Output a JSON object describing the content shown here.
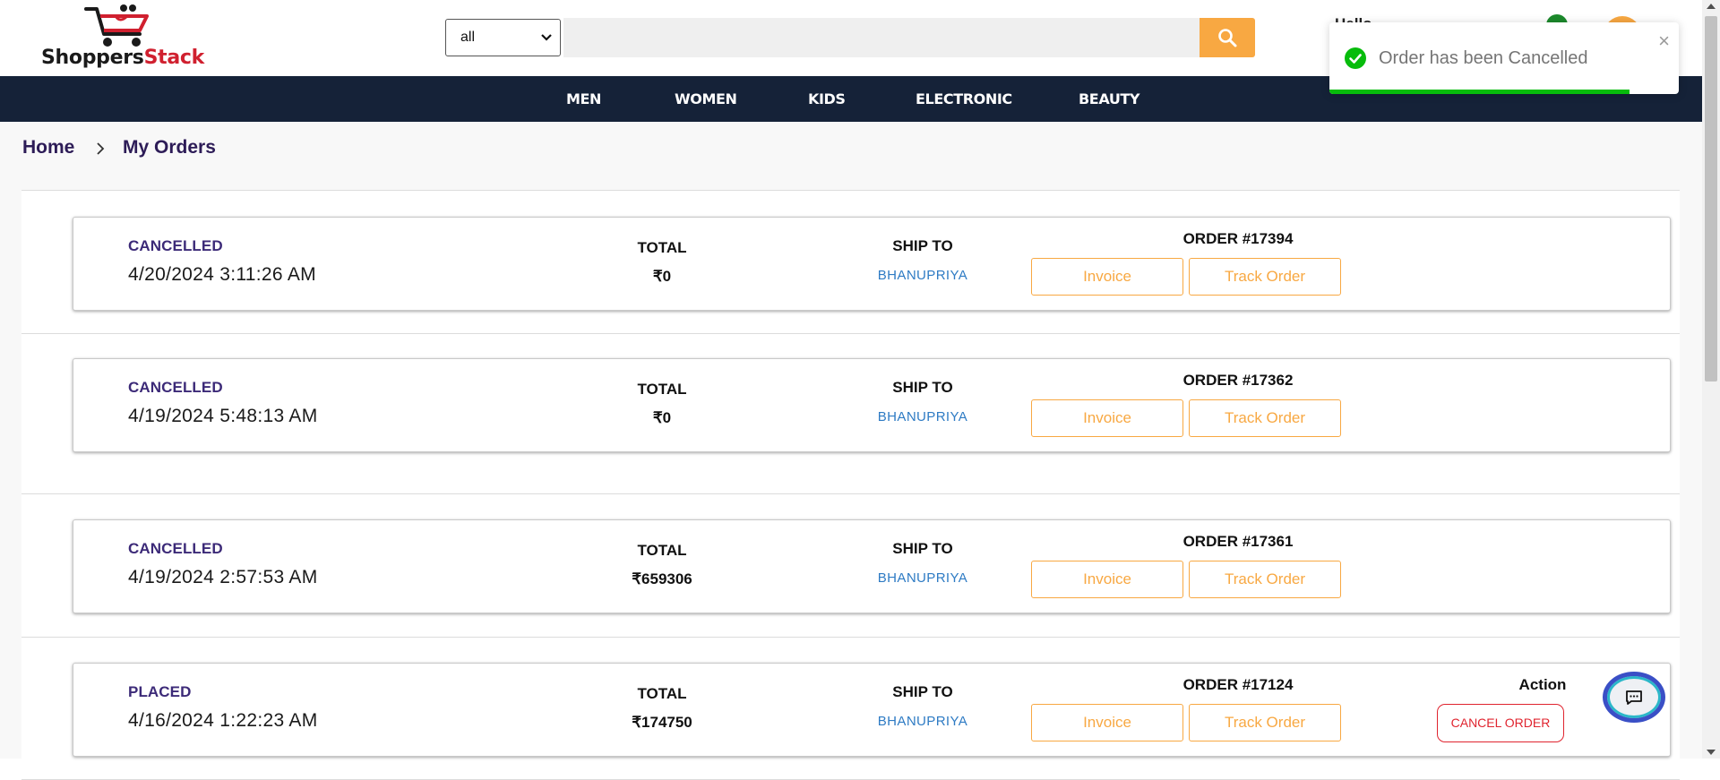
{
  "header": {
    "logo": {
      "part1": "Shoppers",
      "part2": "Stack"
    },
    "search": {
      "category": "all",
      "placeholder": ""
    },
    "greeting": "Hello"
  },
  "nav": [
    "MEN",
    "WOMEN",
    "KIDS",
    "ELECTRONIC",
    "BEAUTY"
  ],
  "breadcrumb": {
    "home": "Home",
    "current": "My Orders"
  },
  "labels": {
    "total": "TOTAL",
    "ship_to": "SHIP TO",
    "invoice": "Invoice",
    "track_order": "Track Order",
    "action": "Action",
    "cancel_order": "CANCEL ORDER"
  },
  "orders": [
    {
      "status": "CANCELLED",
      "date": "4/20/2024 3:11:26 AM",
      "total": "₹0",
      "ship_to": "BHANUPRIYA",
      "order_no": "ORDER #17394"
    },
    {
      "status": "CANCELLED",
      "date": "4/19/2024 5:48:13 AM",
      "total": "₹0",
      "ship_to": "BHANUPRIYA",
      "order_no": "ORDER #17362"
    },
    {
      "status": "CANCELLED",
      "date": "4/19/2024 2:57:53 AM",
      "total": "₹659306",
      "ship_to": "BHANUPRIYA",
      "order_no": "ORDER #17361"
    },
    {
      "status": "PLACED",
      "date": "4/16/2024 1:22:23 AM",
      "total": "₹174750",
      "ship_to": "BHANUPRIYA",
      "order_no": "ORDER #17124"
    }
  ],
  "toast": {
    "message": "Order has been Cancelled",
    "close": "×",
    "progress": 0.86
  },
  "colors": {
    "accent": "#f8a842",
    "nav_bg": "#152238",
    "status": "#3c2a78",
    "ship_to": "#2e7bc4",
    "danger": "#e0242f",
    "success": "#07bc0c"
  },
  "icons": {
    "search": "search-icon",
    "chevron": "chevron-right-icon",
    "check": "check-circle-icon",
    "chat": "chat-icon"
  }
}
